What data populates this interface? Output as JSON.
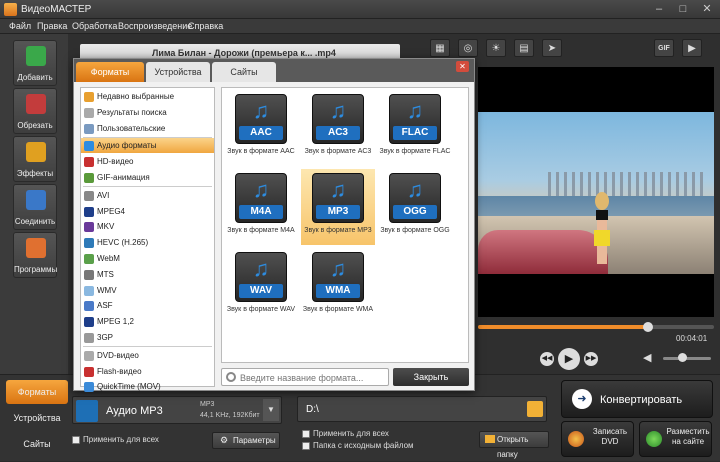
{
  "window": {
    "title": "ВидеоМАСТЕР",
    "minimize": "–",
    "maximize": "□",
    "close": "✕"
  },
  "menu": [
    "Файл",
    "Правка",
    "Обработка",
    "Воспроизведение",
    "Справка"
  ],
  "sidebar": [
    {
      "label": "Добавить",
      "icon": "add-film-icon",
      "color": "#3aa84a"
    },
    {
      "label": "Обрезать",
      "icon": "scissors-icon",
      "color": "#c33c3c"
    },
    {
      "label": "Эффекты",
      "icon": "effects-icon",
      "color": "#e0a020"
    },
    {
      "label": "Соединить",
      "icon": "join-icon",
      "color": "#3a78c8"
    },
    {
      "label": "Программы",
      "icon": "programs-icon",
      "color": "#e07030"
    }
  ],
  "file_header": {
    "title": "Лима Билан - Дорожи (премьера к... .mp4"
  },
  "tool_icons": [
    "crop-icon",
    "stabilize-icon",
    "brightness-icon",
    "filmstrip-icon",
    "speed-icon"
  ],
  "tool_right": [
    "gif-icon",
    "export-frame-icon"
  ],
  "gif_label": "GIF",
  "player": {
    "time": "00:04:01",
    "progress": 0.72,
    "volume": 0.4
  },
  "dialog": {
    "tabs": [
      "Форматы",
      "Устройства",
      "Сайты"
    ],
    "active_tab": 0,
    "categories": [
      {
        "label": "Недавно выбранные",
        "icon": "recent-icon",
        "color": "#e8a030"
      },
      {
        "label": "Результаты поиска",
        "icon": "search-results-icon",
        "color": "#aaaaaa"
      },
      {
        "label": "Пользовательские",
        "icon": "user-icon",
        "color": "#7a9ac0"
      },
      {
        "label": "Аудио форматы",
        "icon": "audio-note-icon",
        "color": "#2d8ce0"
      },
      {
        "label": "HD-видео",
        "icon": "hd-icon",
        "color": "#c83030"
      },
      {
        "label": "GIF-анимация",
        "icon": "gif-icon",
        "color": "#5a9a3a"
      },
      {
        "label": "AVI",
        "icon": "avi-icon",
        "color": "#888888"
      },
      {
        "label": "MPEG4",
        "icon": "mpeg4-icon",
        "color": "#1e3e8a"
      },
      {
        "label": "MKV",
        "icon": "mkv-icon",
        "color": "#6a3a9a"
      },
      {
        "label": "HEVC (H.265)",
        "icon": "hevc-icon",
        "color": "#2e7ab8"
      },
      {
        "label": "WebM",
        "icon": "webm-icon",
        "color": "#5aa04a"
      },
      {
        "label": "MTS",
        "icon": "mts-icon",
        "color": "#777777"
      },
      {
        "label": "WMV",
        "icon": "wmv-icon",
        "color": "#8ab8e0"
      },
      {
        "label": "ASF",
        "icon": "asf-icon",
        "color": "#4a7ac8"
      },
      {
        "label": "MPEG 1,2",
        "icon": "mpeg-icon",
        "color": "#1e3e8a"
      },
      {
        "label": "3GP",
        "icon": "3gp-icon",
        "color": "#999999"
      },
      {
        "label": "DVD-видео",
        "icon": "dvd-icon",
        "color": "#aaaaaa"
      },
      {
        "label": "Flash-видео",
        "icon": "flash-icon",
        "color": "#c83030"
      },
      {
        "label": "QuickTime (MOV)",
        "icon": "quicktime-icon",
        "color": "#3a8ad8"
      }
    ],
    "selected_category": 3,
    "formats": [
      {
        "name": "AAC",
        "caption": "Звук в формате AAC"
      },
      {
        "name": "AC3",
        "caption": "Звук в формате AC3"
      },
      {
        "name": "FLAC",
        "caption": "Звук в формате FLAC"
      },
      {
        "name": "M4A",
        "caption": "Звук в формате M4A"
      },
      {
        "name": "MP3",
        "caption": "Звук в формате MP3"
      },
      {
        "name": "OGG",
        "caption": "Звук в формате OGG"
      },
      {
        "name": "WAV",
        "caption": "Звук в формате WAV"
      },
      {
        "name": "WMA",
        "caption": "Звук в формате WMA"
      }
    ],
    "selected_format": 4,
    "search_placeholder": "Введите название формата...",
    "close_label": "Закрыть",
    "close_x": "✕"
  },
  "bottom": {
    "tabs": [
      "Форматы",
      "Устройства",
      "Сайты"
    ],
    "active_tab": 0,
    "format_name": "Аудио MP3",
    "format_detail1": "MP3",
    "format_detail2": "44,1 KHz, 192Кбит",
    "apply_all": "Применить для всех",
    "params": "Параметры",
    "path": "D:\\",
    "apply_all2": "Применить для всех",
    "source_folder": "Папка с исходным файлом",
    "open_folder": "Открыть папку",
    "convert": "Конвертировать",
    "burn_dvd": "Записать DVD",
    "publish": "Разместить на сайте",
    "accent": "#f08c2a"
  }
}
